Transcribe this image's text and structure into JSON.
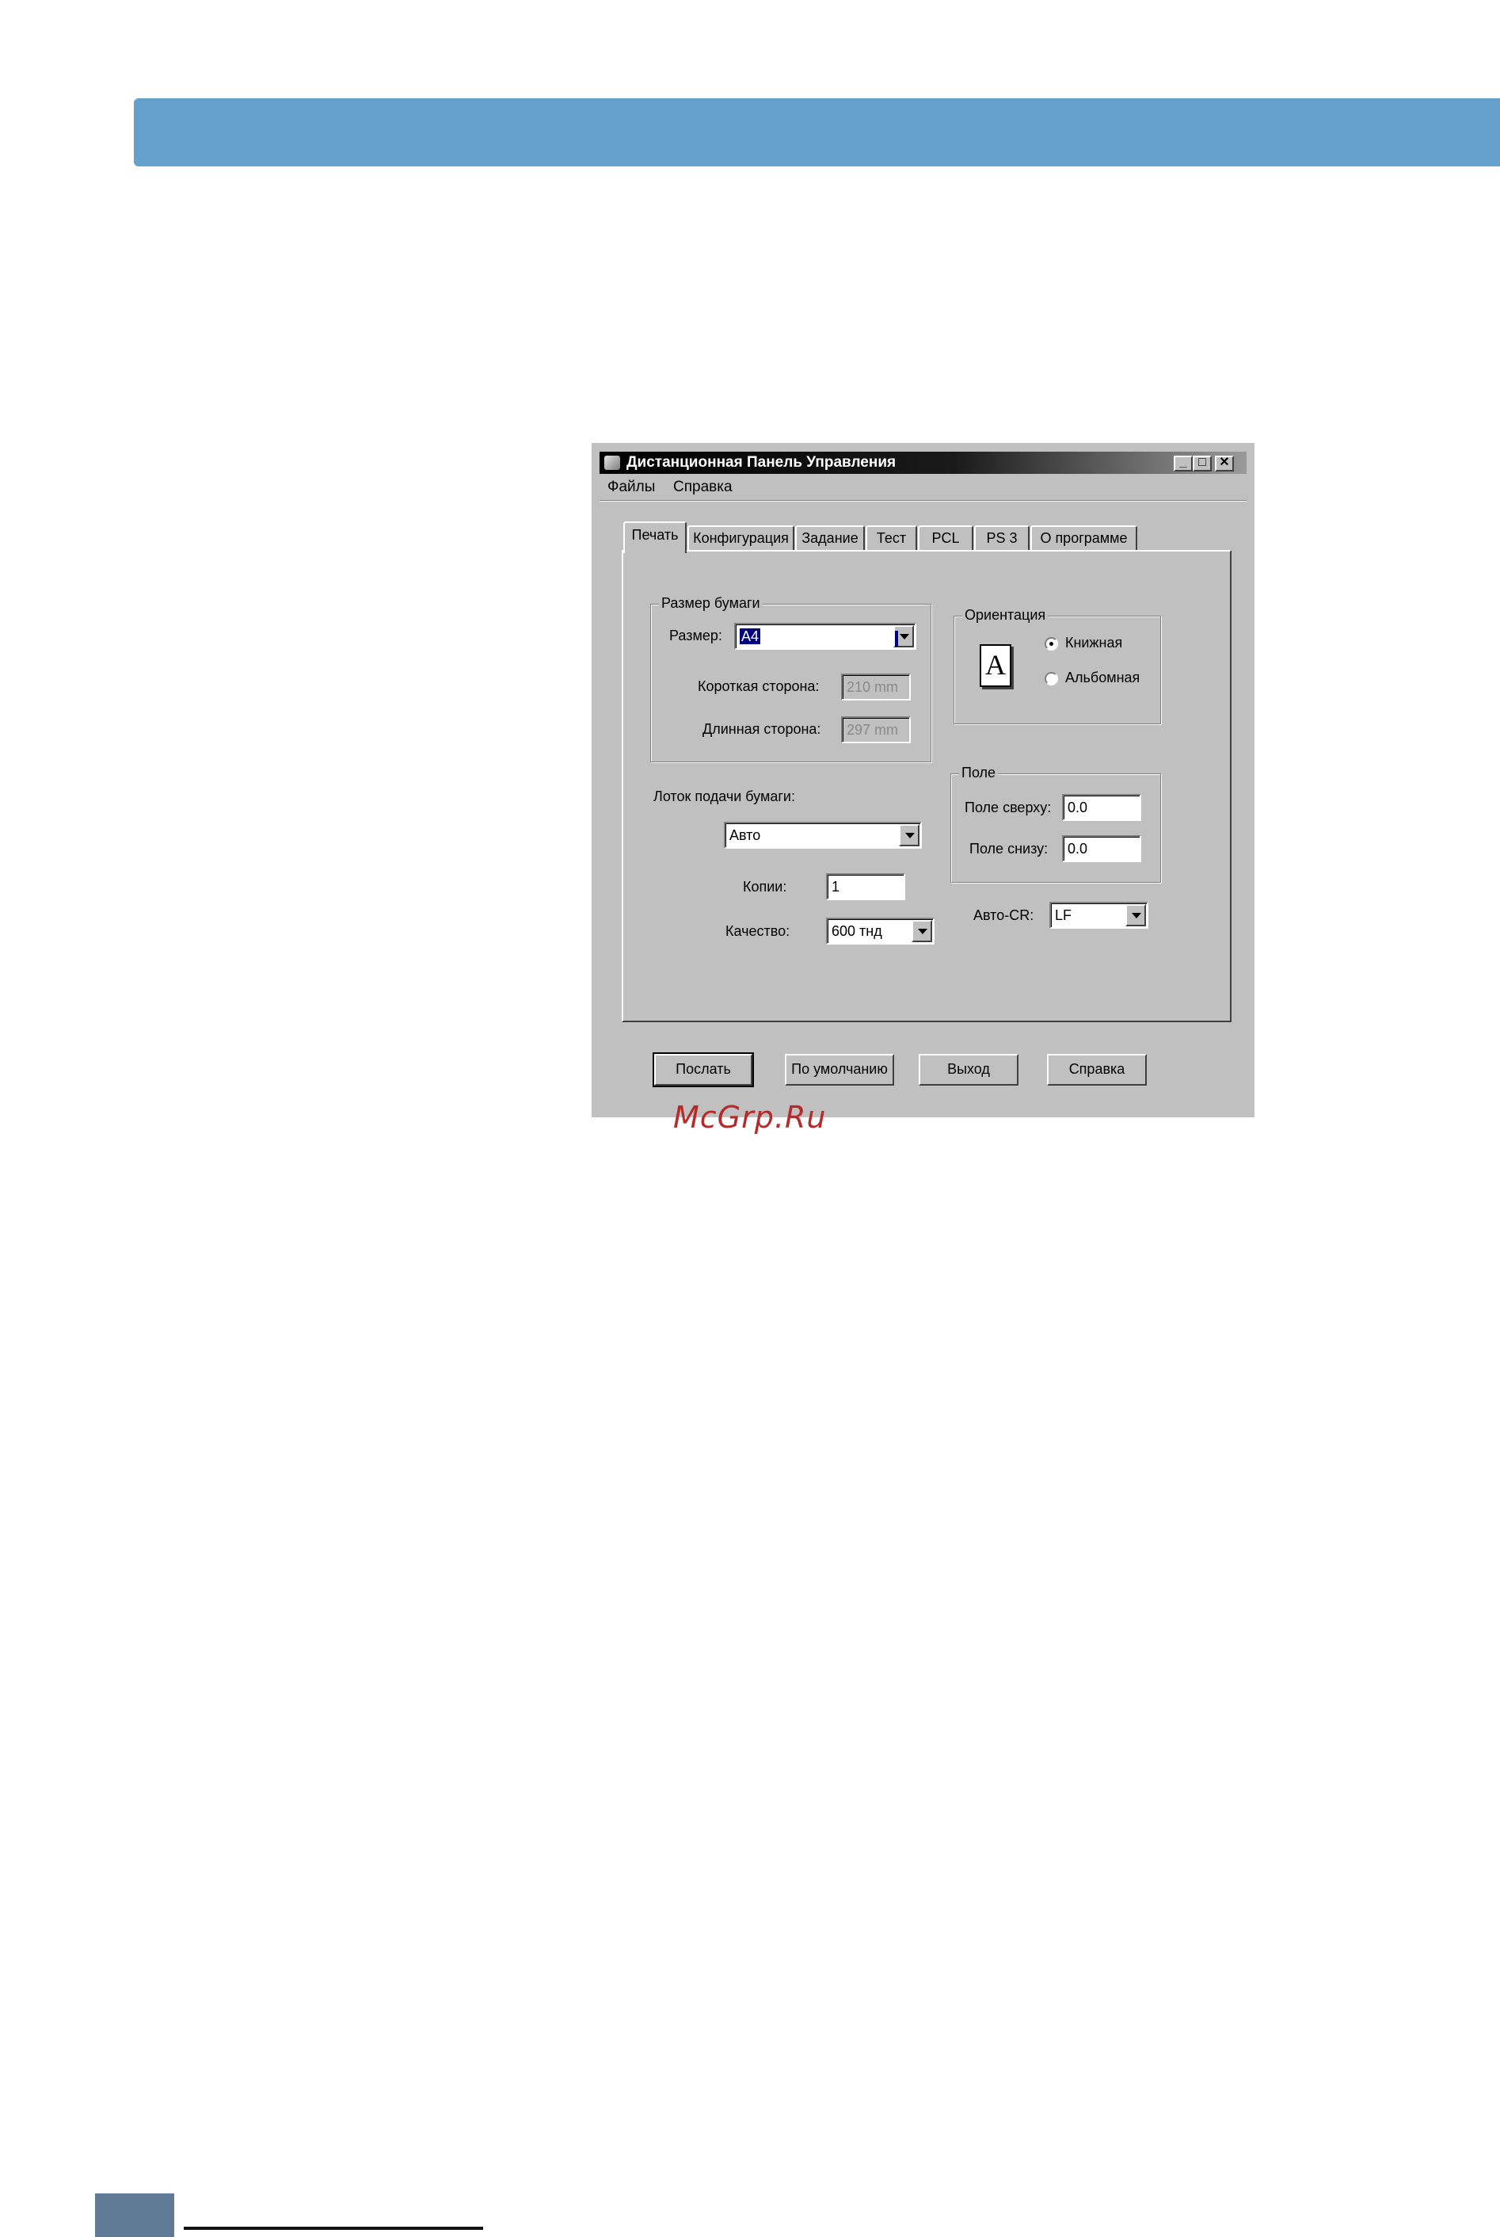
{
  "window": {
    "title": "Дистанционная Панель Управления",
    "controls": {
      "minimize": "_",
      "maximize": "□",
      "close": "✕"
    }
  },
  "menu": {
    "items": [
      {
        "label": "Файлы"
      },
      {
        "label": "Справка"
      }
    ]
  },
  "tabs": [
    {
      "label": "Печать",
      "active": true
    },
    {
      "label": "Конфигурация"
    },
    {
      "label": "Задание"
    },
    {
      "label": "Тест"
    },
    {
      "label": "PCL"
    },
    {
      "label": "PS 3"
    },
    {
      "label": "О программе"
    }
  ],
  "paper_size": {
    "group_label": "Размер бумаги",
    "size_label": "Размер:",
    "size_value": "A4",
    "short_side_label": "Короткая сторона:",
    "short_side_value": "210 mm",
    "long_side_label": "Длинная сторона:",
    "long_side_value": "297 mm"
  },
  "orientation": {
    "group_label": "Ориентация",
    "icon_letter": "A",
    "portrait_label": "Книжная",
    "landscape_label": "Альбомная",
    "selected": "portrait"
  },
  "tray": {
    "label": "Лоток подачи бумаги:",
    "value": "Авто"
  },
  "margins": {
    "group_label": "Поле",
    "top_label": "Поле сверху:",
    "top_value": "0.0",
    "bottom_label": "Поле снизу:",
    "bottom_value": "0.0"
  },
  "copies": {
    "label": "Копии:",
    "value": "1"
  },
  "quality": {
    "label": "Качество:",
    "value": "600 тнд"
  },
  "auto_cr": {
    "label": "Авто-CR:",
    "value": "LF"
  },
  "buttons": {
    "send": "Послать",
    "defaults": "По умолчанию",
    "exit": "Выход",
    "help": "Справка"
  },
  "watermark": "McGrp.Ru",
  "colors": {
    "page_band": "#64a0c9",
    "dialog_face": "#c0c0c0",
    "selection": "#000080",
    "watermark": "#b52a2a",
    "footer_block": "#5e7a94"
  }
}
